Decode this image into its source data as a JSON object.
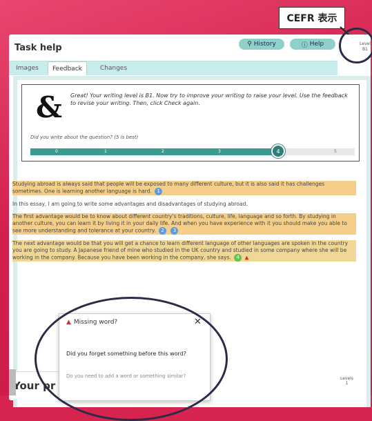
{
  "callout": {
    "label": "CEFR 表示"
  },
  "header": {
    "title": "Task help",
    "history_label": "History",
    "help_label": "Help",
    "level_title": "Level",
    "level_value": "B1"
  },
  "tabs": [
    {
      "label": "Images"
    },
    {
      "label": "Feedback"
    },
    {
      "label": "Changes"
    }
  ],
  "feedback": {
    "message": "Great! Your writing level is B1. Now try to improve your writing to raise your level. Use the feedback to revise your writing. Then, click Check again.",
    "question": "Did you write about the question? (5 is best)",
    "slider_ticks": [
      "0",
      "1",
      "2",
      "3",
      "4",
      "5"
    ],
    "slider_value": 4
  },
  "essay": {
    "p1": "Studying abroad is always said that people will be exposed to many different culture, but it is also said it has challenges sometimes. One is learning another language is hard.",
    "p2": "In this essay, I am going to write some advantages and disadvantages of studying abroad.",
    "p3": "The first advantage would be to know about different country’s traditions, culture, life, language and so forth. By studying in another culture, you can learn it by living it in your daily life. And when you have experience with it you should make you able to see more understanding and tolerance at your country.",
    "p4": "The next advantage would be that you will get a chance to learn different language of other languages are spoken in the country you are going to study. A Japanese friend of mine who studied in the UK country and studied in some company where she will be working in the company. Because you have been working in the company, she says.",
    "pin_labels": [
      "1",
      "2",
      "3",
      "4",
      "5",
      "6"
    ]
  },
  "popup": {
    "title": "Missing word?",
    "body": "Did you forget something before this word?",
    "sub": "Do you need to add a word or something similar?"
  },
  "bottom": {
    "section_title": "Your pr",
    "levels_label": "Levels",
    "levels_value": "1"
  }
}
